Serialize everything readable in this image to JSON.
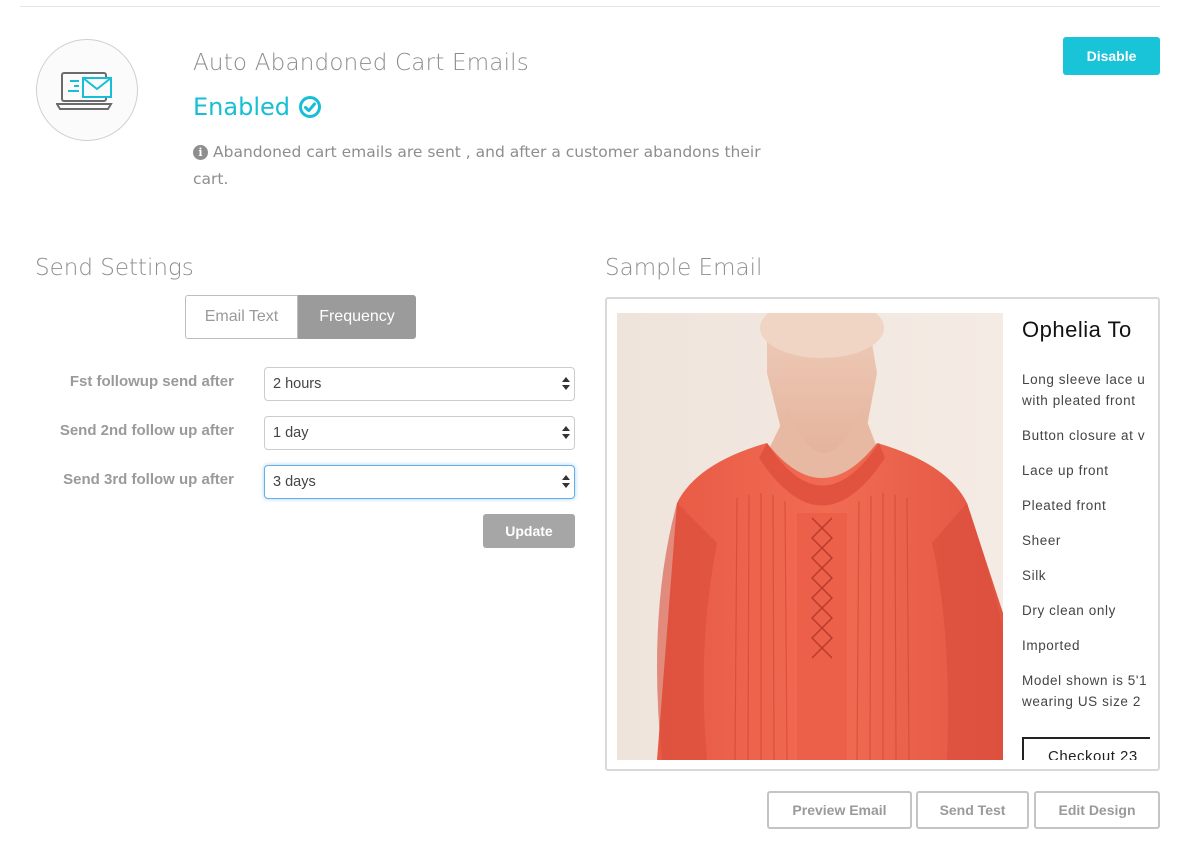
{
  "feature": {
    "title": "Auto Abandoned Cart Emails",
    "status": "Enabled",
    "status_icon": "check-circle-icon",
    "info": "Abandoned cart emails are sent , and after a customer abandons their cart.",
    "icon": "laptop-email-icon",
    "disable_label": "Disable"
  },
  "colors": {
    "accent": "#19c3d8",
    "muted_text": "#8e8e8e",
    "button_gray": "#a6a6a6"
  },
  "send_settings": {
    "heading": "Send Settings",
    "tabs": [
      {
        "label": "Email Text",
        "active": false
      },
      {
        "label": "Frequency",
        "active": true
      }
    ],
    "rows": [
      {
        "label": "Fst followup send after",
        "value": "2 hours"
      },
      {
        "label": "Send 2nd follow up after",
        "value": "1 day"
      },
      {
        "label": "Send 3rd follow up after",
        "value": "3 days"
      }
    ],
    "update_label": "Update"
  },
  "sample_email": {
    "heading": "Sample Email",
    "product_name": "Ophelia To",
    "details": [
      "Long sleeve lace u",
      "with pleated front",
      "Button closure at v",
      "Lace up front",
      "Pleated front",
      "Sheer",
      "Silk",
      "Dry clean only",
      "Imported",
      "Model shown is 5'1",
      "wearing US size 2"
    ],
    "checkout_label": "Checkout 23"
  },
  "actions": {
    "preview": "Preview Email",
    "send_test": "Send Test",
    "edit_design": "Edit Design"
  }
}
